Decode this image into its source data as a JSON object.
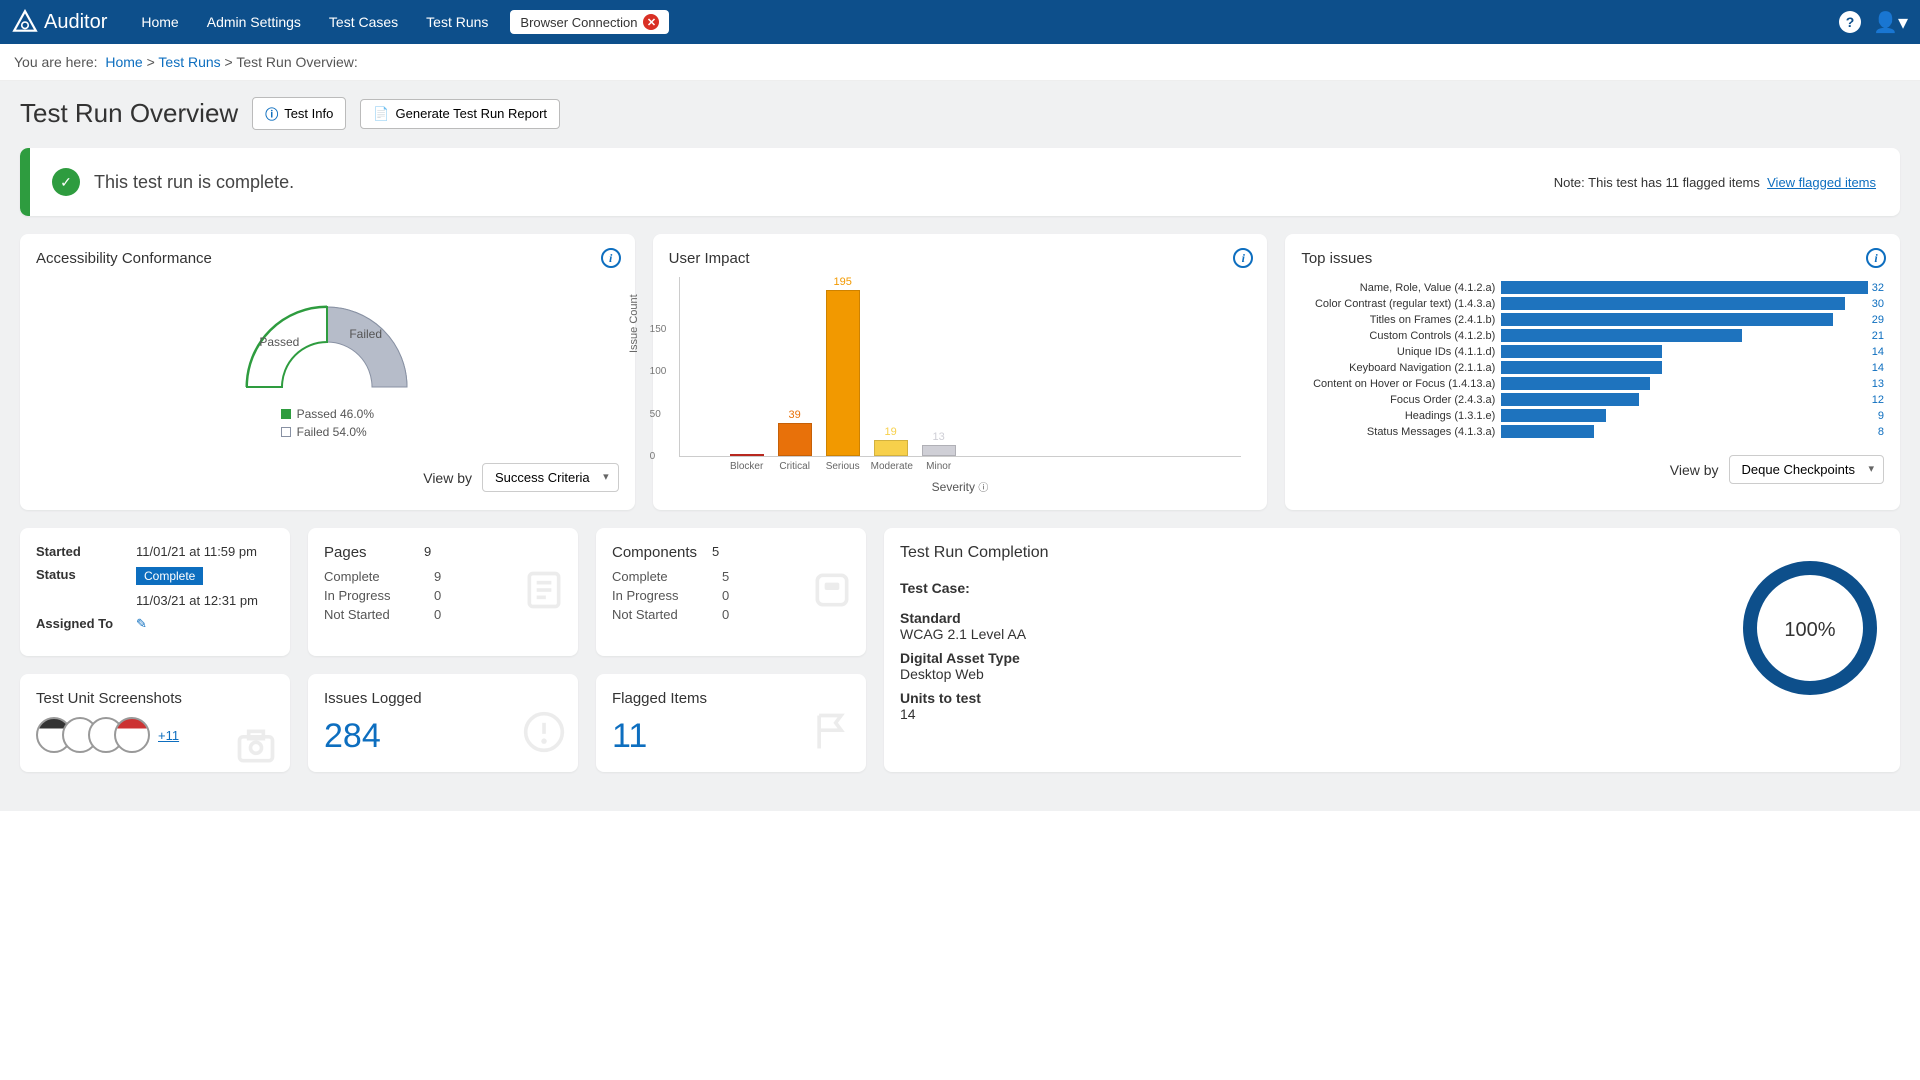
{
  "nav": {
    "brand": "Auditor",
    "links": [
      "Home",
      "Admin Settings",
      "Test Cases",
      "Test Runs"
    ],
    "browser_connection": "Browser Connection"
  },
  "breadcrumb": {
    "prefix": "You are here:",
    "items": [
      "Home",
      "Test Runs",
      "Test Run Overview:"
    ]
  },
  "page": {
    "title": "Test Run Overview",
    "btn_test_info": "Test Info",
    "btn_generate": "Generate Test Run Report"
  },
  "banner": {
    "message": "This test run is complete.",
    "note_prefix": "Note: This test has 11 flagged items",
    "link": "View flagged items"
  },
  "conformance": {
    "title": "Accessibility Conformance",
    "passed_label": "Passed",
    "failed_label": "Failed",
    "legend_passed": "Passed 46.0%",
    "legend_failed": "Failed 54.0%",
    "view_by_label": "View by",
    "view_by_value": "Success Criteria"
  },
  "user_impact": {
    "title": "User Impact",
    "ylabel": "Issue Count",
    "xlabel": "Severity"
  },
  "top_issues": {
    "title": "Top issues",
    "view_by_label": "View by",
    "view_by_value": "Deque Checkpoints"
  },
  "status_card": {
    "started_k": "Started",
    "started_v": "11/01/21 at 11:59 pm",
    "status_k": "Status",
    "status_badge": "Complete",
    "status_date": "11/03/21 at 12:31 pm",
    "assigned_k": "Assigned To"
  },
  "pages_card": {
    "title": "Pages",
    "total": "9",
    "complete_k": "Complete",
    "complete_v": "9",
    "inprog_k": "In Progress",
    "inprog_v": "0",
    "notstart_k": "Not Started",
    "notstart_v": "0"
  },
  "components_card": {
    "title": "Components",
    "total": "5",
    "complete_k": "Complete",
    "complete_v": "5",
    "inprog_k": "In Progress",
    "inprog_v": "0",
    "notstart_k": "Not Started",
    "notstart_v": "0"
  },
  "completion": {
    "title": "Test Run Completion",
    "test_case_k": "Test Case:",
    "standard_k": "Standard",
    "standard_v": "WCAG 2.1 Level AA",
    "asset_k": "Digital Asset Type",
    "asset_v": "Desktop Web",
    "units_k": "Units to test",
    "units_v": "14",
    "pct": "100%"
  },
  "screenshots": {
    "title": "Test Unit Screenshots",
    "plus": "+11"
  },
  "issues": {
    "title": "Issues Logged",
    "count": "284"
  },
  "flagged": {
    "title": "Flagged Items",
    "count": "11"
  },
  "chart_data": [
    {
      "type": "pie",
      "title": "Accessibility Conformance",
      "series": [
        {
          "name": "Passed",
          "value": 46.0,
          "color": "#2e9c3f"
        },
        {
          "name": "Failed",
          "value": 54.0,
          "color": "#9aa0b0"
        }
      ]
    },
    {
      "type": "bar",
      "title": "User Impact",
      "xlabel": "Severity",
      "ylabel": "Issue Count",
      "ylim": [
        0,
        200
      ],
      "categories": [
        "Blocker",
        "Critical",
        "Serious",
        "Moderate",
        "Minor"
      ],
      "values": [
        0,
        39,
        195,
        19,
        13
      ],
      "colors": [
        "#d93025",
        "#e8710a",
        "#f29900",
        "#f7d04b",
        "#cfcfd6"
      ]
    },
    {
      "type": "bar",
      "orientation": "horizontal",
      "title": "Top issues",
      "categories": [
        "Name, Role, Value (4.1.2.a)",
        "Color Contrast (regular text) (1.4.3.a)",
        "Titles on Frames (2.4.1.b)",
        "Custom Controls (4.1.2.b)",
        "Unique IDs (4.1.1.d)",
        "Keyboard Navigation (2.1.1.a)",
        "Content on Hover or Focus (1.4.13.a)",
        "Focus Order (2.4.3.a)",
        "Headings (1.3.1.e)",
        "Status Messages (4.1.3.a)"
      ],
      "values": [
        32,
        30,
        29,
        21,
        14,
        14,
        13,
        12,
        9,
        8
      ]
    }
  ]
}
